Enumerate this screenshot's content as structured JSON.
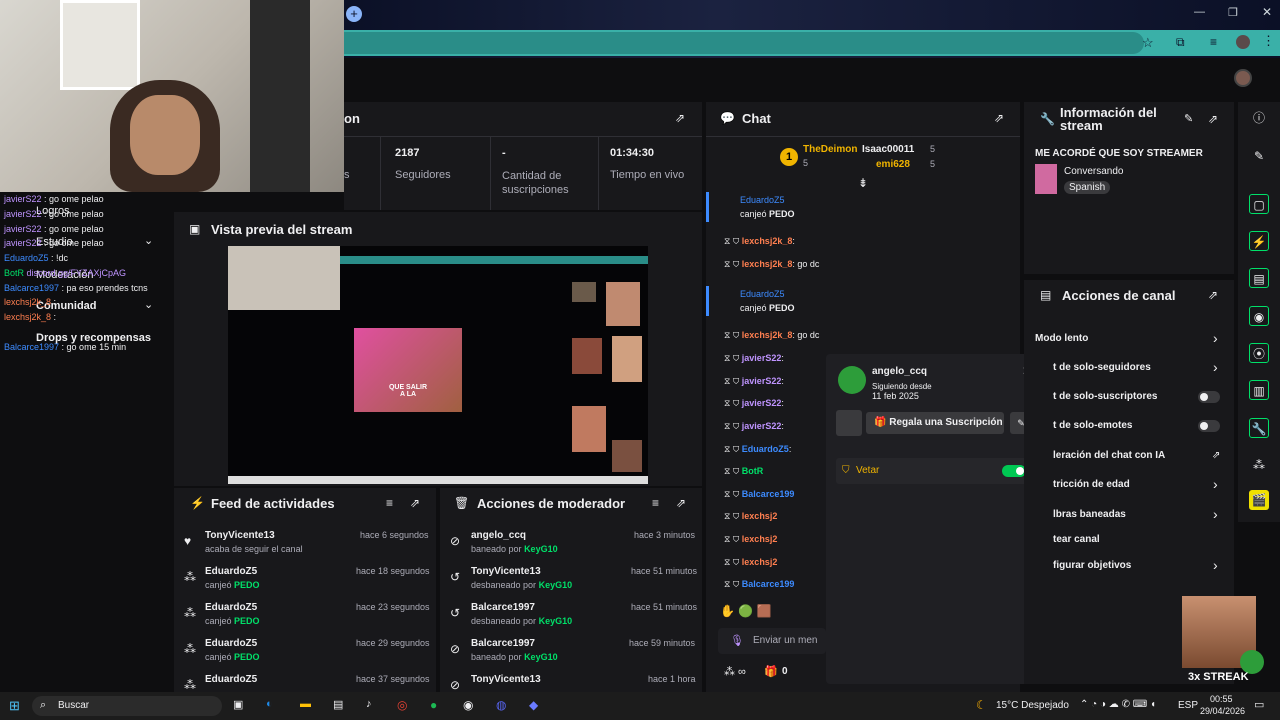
{
  "stats": {
    "title_partial": "on",
    "left_label_partial": "s",
    "followers_value": "2187",
    "followers_label": "Seguidores",
    "subs_value": "-",
    "subs_label": "Cantidad de suscripciones",
    "live_value": "01:34:30",
    "live_label": "Tiempo en vivo"
  },
  "left_menu": {
    "items": [
      "Logros",
      "Estudio",
      "Moderación",
      "Comunidad",
      "Drops y recompensas"
    ]
  },
  "overlay_chat": [
    {
      "user": "javierS22",
      "text": " : go ome pelao"
    },
    {
      "user": "javierS22",
      "text": " : go ome pelao"
    },
    {
      "user": "javierS22",
      "text": " : go ome pelao"
    },
    {
      "user": "javierS22",
      "text": " : go ome pelao"
    },
    {
      "user": "EduardoZ5",
      "text": " : !dc"
    },
    {
      "user": "BotR",
      "text": " discord.gg/FYZAXjCpAG"
    },
    {
      "user": "Balcarce1997",
      "text": " : pa eso prendes tcns"
    },
    {
      "user": "lexchsj2k_8",
      "text": " :"
    },
    {
      "user": "lexchsj2k_8",
      "text": " :"
    },
    {
      "user": "Balcarce1997",
      "text": " : go ome 15 min"
    }
  ],
  "preview": {
    "title": "Vista previa del stream",
    "overlay_text": "QUE SALIR A LA"
  },
  "feed": {
    "title": "Feed de actividades",
    "items": [
      {
        "user": "TonyVicente13",
        "action": "acaba de seguir el canal",
        "time": "hace 6 segundos",
        "highlight": ""
      },
      {
        "user": "EduardoZ5",
        "action": "canjeó",
        "highlight": "PEDO",
        "time": "hace 18 segundos"
      },
      {
        "user": "EduardoZ5",
        "action": "canjeó",
        "highlight": "PEDO",
        "time": "hace 23 segundos"
      },
      {
        "user": "EduardoZ5",
        "action": "canjeó",
        "highlight": "PEDO",
        "time": "hace 29 segundos"
      },
      {
        "user": "EduardoZ5",
        "action": "",
        "highlight": "",
        "time": "hace 37 segundos"
      }
    ]
  },
  "mod_actions": {
    "title": "Acciones de moderador",
    "items": [
      {
        "user": "angelo_ccq",
        "action": "baneado por",
        "by": "KeyG10",
        "time": "hace 3 minutos"
      },
      {
        "user": "TonyVicente13",
        "action": "desbaneado por",
        "by": "KeyG10",
        "time": "hace 51 minutos"
      },
      {
        "user": "Balcarce1997",
        "action": "desbaneado por",
        "by": "KeyG10",
        "time": "hace 51 minutos"
      },
      {
        "user": "Balcarce1997",
        "action": "baneado por",
        "by": "KeyG10",
        "time": "hace 59 minutos"
      },
      {
        "user": "TonyVicente13",
        "action": "",
        "by": "",
        "time": "hace 1 hora"
      }
    ]
  },
  "chat": {
    "title": "Chat",
    "leaders": [
      {
        "rank": "1",
        "name": "TheDeimon",
        "count": "5"
      },
      {
        "name": "Isaac00011",
        "count": "5"
      },
      {
        "name": "emi628",
        "count": "5"
      }
    ],
    "redeem1": {
      "user": "EduardoZ5",
      "text": "canjeó",
      "reward": "PEDO"
    },
    "redeem2": {
      "user": "EduardoZ5",
      "text": "canjeó",
      "reward": "PEDO"
    },
    "messages": [
      {
        "user": "lexchsj2k_8",
        "text": ":",
        "color": "#ff7f50"
      },
      {
        "user": "lexchsj2k_8",
        "text": ": go dc",
        "color": "#ff7f50"
      },
      {
        "user": "lexchsj2k_8",
        "text": ": go dc",
        "color": "#ff7f50"
      },
      {
        "user": "javierS22",
        "text": ":",
        "color": "#bf94ff"
      },
      {
        "user": "javierS22",
        "text": ":",
        "color": "#bf94ff"
      },
      {
        "user": "javierS22",
        "text": ":",
        "color": "#bf94ff"
      },
      {
        "user": "javierS22",
        "text": ":",
        "color": "#bf94ff"
      },
      {
        "user": "EduardoZ5",
        "text": ":",
        "color": "#3d8bff"
      },
      {
        "user": "BotR",
        "text": "",
        "color": "#00e069"
      },
      {
        "user": "Balcarce199",
        "text": "",
        "color": "#3d8bff"
      },
      {
        "user": "lexchsj2",
        "text": "",
        "color": "#ff7f50"
      },
      {
        "user": "lexchsj2",
        "text": "",
        "color": "#ff7f50"
      },
      {
        "user": "lexchsj2",
        "text": "",
        "color": "#ff7f50"
      },
      {
        "user": "Balcarce199",
        "text": "",
        "color": "#3d8bff"
      }
    ],
    "input_placeholder": "Enviar un men",
    "points": "0"
  },
  "user_card": {
    "name": "angelo_ccq",
    "since_label": "Siguiendo desde",
    "since_date": "11 feb 2025",
    "gift_label": "Regala una Suscripción",
    "veto_label": "Vetar"
  },
  "stream_info": {
    "title": "Información del stream",
    "stream_title": "ME ACORDÉ QUE SOY STREAMER",
    "category": "Conversando",
    "tag": "Spanish"
  },
  "channel_actions": {
    "title": "Acciones de canal",
    "items": [
      "Modo lento",
      "t de solo-seguidores",
      "t de solo-suscriptores",
      "t de solo-emotes",
      "leración del chat con IA",
      "tricción de edad",
      "lbras baneadas",
      "tear canal",
      "figurar objetivos"
    ]
  },
  "overlay_streak": "3x STREAK",
  "taskbar": {
    "search": "Buscar",
    "weather": "15°C Despejado",
    "lang": "ESP",
    "time": "00:55",
    "date": "29/04/2026"
  },
  "colors": {
    "accent": "#00e069",
    "purple": "#9147ff",
    "bg": "#0e0e10",
    "panel": "#18181b"
  }
}
